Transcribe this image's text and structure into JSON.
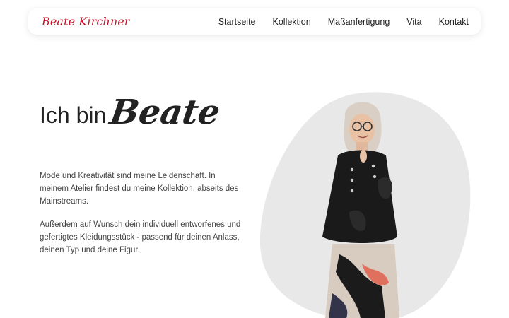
{
  "brand": {
    "name": "Beate Kirchner",
    "color": "#c8102e"
  },
  "nav": {
    "items": [
      "Startseite",
      "Kollektion",
      "Maßanfertigung",
      "Vita",
      "Kontakt"
    ]
  },
  "hero": {
    "title_plain": "Ich bin",
    "title_script": "Beate",
    "paragraph1": "Mode und Kreativität sind meine Leidenschaft. In meinem Atelier findest du meine Kollektion, abseits des Mainstreams.",
    "paragraph2": "Außerdem auf Wunsch dein individuell entworfenes und gefertigtes Kleidungsstück - passend für deinen Anlass, deinen Typ und deine Figur."
  },
  "colors": {
    "blob": "#e8e8e8",
    "text": "#444444"
  }
}
